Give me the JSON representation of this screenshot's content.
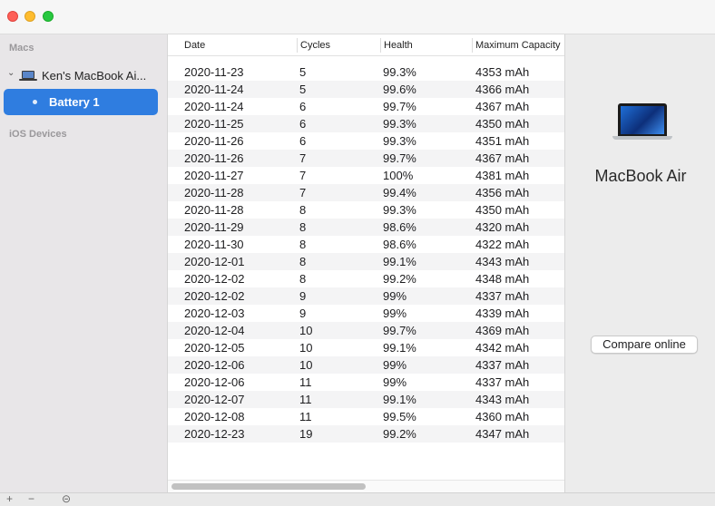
{
  "window": {
    "colors": {
      "close": "#fe5f57",
      "minimize": "#febc2e",
      "zoom": "#28c840",
      "selection": "#2f7de0"
    }
  },
  "sidebar": {
    "section_macs": "Macs",
    "mac_item": "Ken's MacBook Ai...",
    "battery_item": "Battery 1",
    "section_ios": "iOS Devices"
  },
  "table": {
    "columns": [
      "Date",
      "Cycles",
      "Health",
      "Maximum Capacity"
    ],
    "rows": [
      [
        "2020-11-23",
        "5",
        "99.3%",
        "4353 mAh"
      ],
      [
        "2020-11-24",
        "5",
        "99.6%",
        "4366 mAh"
      ],
      [
        "2020-11-24",
        "6",
        "99.7%",
        "4367 mAh"
      ],
      [
        "2020-11-25",
        "6",
        "99.3%",
        "4350 mAh"
      ],
      [
        "2020-11-26",
        "6",
        "99.3%",
        "4351 mAh"
      ],
      [
        "2020-11-26",
        "7",
        "99.7%",
        "4367 mAh"
      ],
      [
        "2020-11-27",
        "7",
        "100%",
        "4381 mAh"
      ],
      [
        "2020-11-28",
        "7",
        "99.4%",
        "4356 mAh"
      ],
      [
        "2020-11-28",
        "8",
        "99.3%",
        "4350 mAh"
      ],
      [
        "2020-11-29",
        "8",
        "98.6%",
        "4320 mAh"
      ],
      [
        "2020-11-30",
        "8",
        "98.6%",
        "4322 mAh"
      ],
      [
        "2020-12-01",
        "8",
        "99.1%",
        "4343 mAh"
      ],
      [
        "2020-12-02",
        "8",
        "99.2%",
        "4348 mAh"
      ],
      [
        "2020-12-02",
        "9",
        "99%",
        "4337 mAh"
      ],
      [
        "2020-12-03",
        "9",
        "99%",
        "4339 mAh"
      ],
      [
        "2020-12-04",
        "10",
        "99.7%",
        "4369 mAh"
      ],
      [
        "2020-12-05",
        "10",
        "99.1%",
        "4342 mAh"
      ],
      [
        "2020-12-06",
        "10",
        "99%",
        "4337 mAh"
      ],
      [
        "2020-12-06",
        "11",
        "99%",
        "4337 mAh"
      ],
      [
        "2020-12-07",
        "11",
        "99.1%",
        "4343 mAh"
      ],
      [
        "2020-12-08",
        "11",
        "99.5%",
        "4360 mAh"
      ],
      [
        "2020-12-23",
        "19",
        "99.2%",
        "4347 mAh"
      ]
    ]
  },
  "detail": {
    "device_icon": "macbook-air-icon",
    "device_name": "MacBook Air",
    "compare_button": "Compare online"
  },
  "bottombar": {
    "add": "+",
    "remove": "−",
    "options": "⊝"
  }
}
